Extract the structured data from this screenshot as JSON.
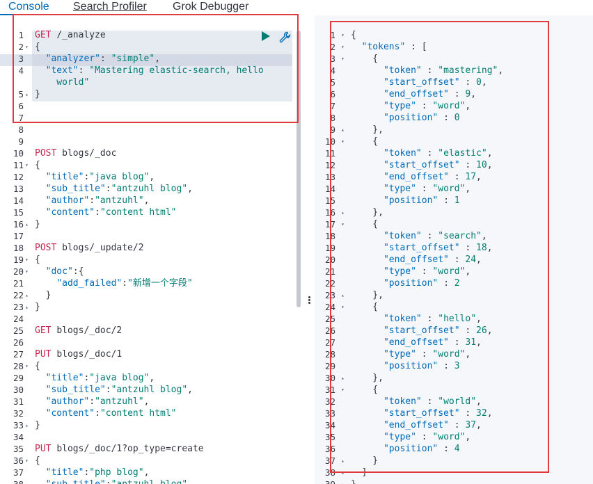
{
  "tabs": [
    {
      "label": "Console"
    },
    {
      "label": "Search Profiler"
    },
    {
      "label": "Grok Debugger"
    }
  ],
  "toolbar": {
    "run_icon": "play-icon",
    "settings_icon": "wrench-icon"
  },
  "colors": {
    "accent": "#006bb8",
    "method": "#c7254e",
    "string": "#017d73",
    "annotation": "#e0393e"
  },
  "request_lines": [
    {
      "n": "1",
      "fold": "",
      "segs": [
        [
          "m",
          "GET "
        ],
        [
          "p",
          "/_analyze"
        ]
      ]
    },
    {
      "n": "2",
      "fold": "▾",
      "segs": [
        [
          "u",
          "{"
        ]
      ]
    },
    {
      "n": "3",
      "fold": "",
      "segs": [
        [
          "u",
          "  "
        ],
        [
          "k",
          "\"analyzer\""
        ],
        [
          "u",
          ": "
        ],
        [
          "s",
          "\"simple\""
        ],
        [
          "u",
          ","
        ]
      ]
    },
    {
      "n": "4",
      "fold": "",
      "segs": [
        [
          "u",
          "  "
        ],
        [
          "k",
          "\"text\""
        ],
        [
          "u",
          ": "
        ],
        [
          "s",
          "\"Mastering elastic-search, hello"
        ]
      ]
    },
    {
      "n": "",
      "fold": "",
      "segs": [
        [
          "s",
          "    world\""
        ]
      ]
    },
    {
      "n": "5",
      "fold": "▴",
      "segs": [
        [
          "u",
          "}"
        ]
      ]
    },
    {
      "n": "6",
      "fold": "",
      "segs": []
    },
    {
      "n": "7",
      "fold": "",
      "segs": []
    },
    {
      "n": "8",
      "fold": "",
      "segs": []
    },
    {
      "n": "9",
      "fold": "",
      "segs": []
    },
    {
      "n": "10",
      "fold": "",
      "segs": [
        [
          "m",
          "POST "
        ],
        [
          "p",
          "blogs/_doc"
        ]
      ]
    },
    {
      "n": "11",
      "fold": "▾",
      "segs": [
        [
          "u",
          "{"
        ]
      ]
    },
    {
      "n": "12",
      "fold": "",
      "segs": [
        [
          "u",
          "  "
        ],
        [
          "k",
          "\"title\""
        ],
        [
          "u",
          ":"
        ],
        [
          "s",
          "\"java blog\""
        ],
        [
          "u",
          ","
        ]
      ]
    },
    {
      "n": "13",
      "fold": "",
      "segs": [
        [
          "u",
          "  "
        ],
        [
          "k",
          "\"sub_title\""
        ],
        [
          "u",
          ":"
        ],
        [
          "s",
          "\"antzuhl blog\""
        ],
        [
          "u",
          ","
        ]
      ]
    },
    {
      "n": "14",
      "fold": "",
      "segs": [
        [
          "u",
          "  "
        ],
        [
          "k",
          "\"author\""
        ],
        [
          "u",
          ":"
        ],
        [
          "s",
          "\"antzuhl\""
        ],
        [
          "u",
          ","
        ]
      ]
    },
    {
      "n": "15",
      "fold": "",
      "segs": [
        [
          "u",
          "  "
        ],
        [
          "k",
          "\"content\""
        ],
        [
          "u",
          ":"
        ],
        [
          "s",
          "\"content html\""
        ]
      ]
    },
    {
      "n": "16",
      "fold": "▴",
      "segs": [
        [
          "u",
          "}"
        ]
      ]
    },
    {
      "n": "17",
      "fold": "",
      "segs": []
    },
    {
      "n": "18",
      "fold": "",
      "segs": [
        [
          "m",
          "POST "
        ],
        [
          "p",
          "blogs/_update/2"
        ]
      ]
    },
    {
      "n": "19",
      "fold": "▾",
      "segs": [
        [
          "u",
          "{"
        ]
      ]
    },
    {
      "n": "20",
      "fold": "▾",
      "segs": [
        [
          "u",
          "  "
        ],
        [
          "k",
          "\"doc\""
        ],
        [
          "u",
          ":{"
        ]
      ]
    },
    {
      "n": "21",
      "fold": "",
      "segs": [
        [
          "u",
          "    "
        ],
        [
          "k",
          "\"add_failed\""
        ],
        [
          "u",
          ":"
        ],
        [
          "s",
          "\"新增一个字段\""
        ]
      ]
    },
    {
      "n": "22",
      "fold": "▴",
      "segs": [
        [
          "u",
          "  }"
        ]
      ]
    },
    {
      "n": "23",
      "fold": "▴",
      "segs": [
        [
          "u",
          "}"
        ]
      ]
    },
    {
      "n": "24",
      "fold": "",
      "segs": []
    },
    {
      "n": "25",
      "fold": "",
      "segs": [
        [
          "m",
          "GET "
        ],
        [
          "p",
          "blogs/_doc/2"
        ]
      ]
    },
    {
      "n": "26",
      "fold": "",
      "segs": []
    },
    {
      "n": "27",
      "fold": "",
      "segs": [
        [
          "m",
          "PUT "
        ],
        [
          "p",
          "blogs/_doc/1"
        ]
      ]
    },
    {
      "n": "28",
      "fold": "▾",
      "segs": [
        [
          "u",
          "{"
        ]
      ]
    },
    {
      "n": "29",
      "fold": "",
      "segs": [
        [
          "u",
          "  "
        ],
        [
          "k",
          "\"title\""
        ],
        [
          "u",
          ":"
        ],
        [
          "s",
          "\"java blog\""
        ],
        [
          "u",
          ","
        ]
      ]
    },
    {
      "n": "30",
      "fold": "",
      "segs": [
        [
          "u",
          "  "
        ],
        [
          "k",
          "\"sub_title\""
        ],
        [
          "u",
          ":"
        ],
        [
          "s",
          "\"antzuhl blog\""
        ],
        [
          "u",
          ","
        ]
      ]
    },
    {
      "n": "31",
      "fold": "",
      "segs": [
        [
          "u",
          "  "
        ],
        [
          "k",
          "\"author\""
        ],
        [
          "u",
          ":"
        ],
        [
          "s",
          "\"antzuhl\""
        ],
        [
          "u",
          ","
        ]
      ]
    },
    {
      "n": "32",
      "fold": "",
      "segs": [
        [
          "u",
          "  "
        ],
        [
          "k",
          "\"content\""
        ],
        [
          "u",
          ":"
        ],
        [
          "s",
          "\"content html\""
        ]
      ]
    },
    {
      "n": "33",
      "fold": "▴",
      "segs": [
        [
          "u",
          "}"
        ]
      ]
    },
    {
      "n": "34",
      "fold": "",
      "segs": []
    },
    {
      "n": "35",
      "fold": "",
      "segs": [
        [
          "m",
          "PUT "
        ],
        [
          "p",
          "blogs/_doc/1?op_type=create"
        ]
      ]
    },
    {
      "n": "36",
      "fold": "▾",
      "segs": [
        [
          "u",
          "{"
        ]
      ]
    },
    {
      "n": "37",
      "fold": "",
      "segs": [
        [
          "u",
          "  "
        ],
        [
          "k",
          "\"title\""
        ],
        [
          "u",
          ":"
        ],
        [
          "s",
          "\"php blog\""
        ],
        [
          "u",
          ","
        ]
      ]
    },
    {
      "n": "38",
      "fold": "",
      "segs": [
        [
          "u",
          "  "
        ],
        [
          "k",
          "\"sub_title\""
        ],
        [
          "u",
          ":"
        ],
        [
          "s",
          "\"antzuhl blog\""
        ],
        [
          "u",
          ","
        ]
      ]
    }
  ],
  "response_lines": [
    {
      "n": "1",
      "fold": "▾",
      "segs": [
        [
          "u",
          "{"
        ]
      ]
    },
    {
      "n": "2",
      "fold": "▾",
      "segs": [
        [
          "u",
          "  "
        ],
        [
          "k",
          "\"tokens\""
        ],
        [
          "u",
          " : ["
        ]
      ]
    },
    {
      "n": "3",
      "fold": "▾",
      "segs": [
        [
          "u",
          "    {"
        ]
      ]
    },
    {
      "n": "4",
      "fold": "",
      "segs": [
        [
          "u",
          "      "
        ],
        [
          "k",
          "\"token\""
        ],
        [
          "u",
          " : "
        ],
        [
          "s",
          "\"mastering\""
        ],
        [
          "u",
          ","
        ]
      ]
    },
    {
      "n": "5",
      "fold": "",
      "segs": [
        [
          "u",
          "      "
        ],
        [
          "k",
          "\"start_offset\""
        ],
        [
          "u",
          " : "
        ],
        [
          "n",
          "0"
        ],
        [
          "u",
          ","
        ]
      ]
    },
    {
      "n": "6",
      "fold": "",
      "segs": [
        [
          "u",
          "      "
        ],
        [
          "k",
          "\"end_offset\""
        ],
        [
          "u",
          " : "
        ],
        [
          "n",
          "9"
        ],
        [
          "u",
          ","
        ]
      ]
    },
    {
      "n": "7",
      "fold": "",
      "segs": [
        [
          "u",
          "      "
        ],
        [
          "k",
          "\"type\""
        ],
        [
          "u",
          " : "
        ],
        [
          "s",
          "\"word\""
        ],
        [
          "u",
          ","
        ]
      ]
    },
    {
      "n": "8",
      "fold": "",
      "segs": [
        [
          "u",
          "      "
        ],
        [
          "k",
          "\"position\""
        ],
        [
          "u",
          " : "
        ],
        [
          "n",
          "0"
        ]
      ]
    },
    {
      "n": "9",
      "fold": "▴",
      "segs": [
        [
          "u",
          "    },"
        ]
      ]
    },
    {
      "n": "10",
      "fold": "▾",
      "segs": [
        [
          "u",
          "    {"
        ]
      ]
    },
    {
      "n": "11",
      "fold": "",
      "segs": [
        [
          "u",
          "      "
        ],
        [
          "k",
          "\"token\""
        ],
        [
          "u",
          " : "
        ],
        [
          "s",
          "\"elastic\""
        ],
        [
          "u",
          ","
        ]
      ]
    },
    {
      "n": "12",
      "fold": "",
      "segs": [
        [
          "u",
          "      "
        ],
        [
          "k",
          "\"start_offset\""
        ],
        [
          "u",
          " : "
        ],
        [
          "n",
          "10"
        ],
        [
          "u",
          ","
        ]
      ]
    },
    {
      "n": "13",
      "fold": "",
      "segs": [
        [
          "u",
          "      "
        ],
        [
          "k",
          "\"end_offset\""
        ],
        [
          "u",
          " : "
        ],
        [
          "n",
          "17"
        ],
        [
          "u",
          ","
        ]
      ]
    },
    {
      "n": "14",
      "fold": "",
      "segs": [
        [
          "u",
          "      "
        ],
        [
          "k",
          "\"type\""
        ],
        [
          "u",
          " : "
        ],
        [
          "s",
          "\"word\""
        ],
        [
          "u",
          ","
        ]
      ]
    },
    {
      "n": "15",
      "fold": "",
      "segs": [
        [
          "u",
          "      "
        ],
        [
          "k",
          "\"position\""
        ],
        [
          "u",
          " : "
        ],
        [
          "n",
          "1"
        ]
      ]
    },
    {
      "n": "16",
      "fold": "▴",
      "segs": [
        [
          "u",
          "    },"
        ]
      ]
    },
    {
      "n": "17",
      "fold": "▾",
      "segs": [
        [
          "u",
          "    {"
        ]
      ]
    },
    {
      "n": "18",
      "fold": "",
      "segs": [
        [
          "u",
          "      "
        ],
        [
          "k",
          "\"token\""
        ],
        [
          "u",
          " : "
        ],
        [
          "s",
          "\"search\""
        ],
        [
          "u",
          ","
        ]
      ]
    },
    {
      "n": "19",
      "fold": "",
      "segs": [
        [
          "u",
          "      "
        ],
        [
          "k",
          "\"start_offset\""
        ],
        [
          "u",
          " : "
        ],
        [
          "n",
          "18"
        ],
        [
          "u",
          ","
        ]
      ]
    },
    {
      "n": "20",
      "fold": "",
      "segs": [
        [
          "u",
          "      "
        ],
        [
          "k",
          "\"end_offset\""
        ],
        [
          "u",
          " : "
        ],
        [
          "n",
          "24"
        ],
        [
          "u",
          ","
        ]
      ]
    },
    {
      "n": "21",
      "fold": "",
      "segs": [
        [
          "u",
          "      "
        ],
        [
          "k",
          "\"type\""
        ],
        [
          "u",
          " : "
        ],
        [
          "s",
          "\"word\""
        ],
        [
          "u",
          ","
        ]
      ]
    },
    {
      "n": "22",
      "fold": "",
      "segs": [
        [
          "u",
          "      "
        ],
        [
          "k",
          "\"position\""
        ],
        [
          "u",
          " : "
        ],
        [
          "n",
          "2"
        ]
      ]
    },
    {
      "n": "23",
      "fold": "▴",
      "segs": [
        [
          "u",
          "    },"
        ]
      ]
    },
    {
      "n": "24",
      "fold": "▾",
      "segs": [
        [
          "u",
          "    {"
        ]
      ]
    },
    {
      "n": "25",
      "fold": "",
      "segs": [
        [
          "u",
          "      "
        ],
        [
          "k",
          "\"token\""
        ],
        [
          "u",
          " : "
        ],
        [
          "s",
          "\"hello\""
        ],
        [
          "u",
          ","
        ]
      ]
    },
    {
      "n": "26",
      "fold": "",
      "segs": [
        [
          "u",
          "      "
        ],
        [
          "k",
          "\"start_offset\""
        ],
        [
          "u",
          " : "
        ],
        [
          "n",
          "26"
        ],
        [
          "u",
          ","
        ]
      ]
    },
    {
      "n": "27",
      "fold": "",
      "segs": [
        [
          "u",
          "      "
        ],
        [
          "k",
          "\"end_offset\""
        ],
        [
          "u",
          " : "
        ],
        [
          "n",
          "31"
        ],
        [
          "u",
          ","
        ]
      ]
    },
    {
      "n": "28",
      "fold": "",
      "segs": [
        [
          "u",
          "      "
        ],
        [
          "k",
          "\"type\""
        ],
        [
          "u",
          " : "
        ],
        [
          "s",
          "\"word\""
        ],
        [
          "u",
          ","
        ]
      ]
    },
    {
      "n": "29",
      "fold": "",
      "segs": [
        [
          "u",
          "      "
        ],
        [
          "k",
          "\"position\""
        ],
        [
          "u",
          " : "
        ],
        [
          "n",
          "3"
        ]
      ]
    },
    {
      "n": "30",
      "fold": "▴",
      "segs": [
        [
          "u",
          "    },"
        ]
      ]
    },
    {
      "n": "31",
      "fold": "▾",
      "segs": [
        [
          "u",
          "    {"
        ]
      ]
    },
    {
      "n": "32",
      "fold": "",
      "segs": [
        [
          "u",
          "      "
        ],
        [
          "k",
          "\"token\""
        ],
        [
          "u",
          " : "
        ],
        [
          "s",
          "\"world\""
        ],
        [
          "u",
          ","
        ]
      ]
    },
    {
      "n": "33",
      "fold": "",
      "segs": [
        [
          "u",
          "      "
        ],
        [
          "k",
          "\"start_offset\""
        ],
        [
          "u",
          " : "
        ],
        [
          "n",
          "32"
        ],
        [
          "u",
          ","
        ]
      ]
    },
    {
      "n": "34",
      "fold": "",
      "segs": [
        [
          "u",
          "      "
        ],
        [
          "k",
          "\"end_offset\""
        ],
        [
          "u",
          " : "
        ],
        [
          "n",
          "37"
        ],
        [
          "u",
          ","
        ]
      ]
    },
    {
      "n": "35",
      "fold": "",
      "segs": [
        [
          "u",
          "      "
        ],
        [
          "k",
          "\"type\""
        ],
        [
          "u",
          " : "
        ],
        [
          "s",
          "\"word\""
        ],
        [
          "u",
          ","
        ]
      ]
    },
    {
      "n": "36",
      "fold": "",
      "segs": [
        [
          "u",
          "      "
        ],
        [
          "k",
          "\"position\""
        ],
        [
          "u",
          " : "
        ],
        [
          "n",
          "4"
        ]
      ]
    },
    {
      "n": "37",
      "fold": "▴",
      "segs": [
        [
          "u",
          "    }"
        ]
      ]
    },
    {
      "n": "38",
      "fold": "▴",
      "segs": [
        [
          "u",
          "  ]"
        ]
      ]
    },
    {
      "n": "39",
      "fold": "▴",
      "segs": [
        [
          "u",
          "}"
        ]
      ]
    }
  ]
}
